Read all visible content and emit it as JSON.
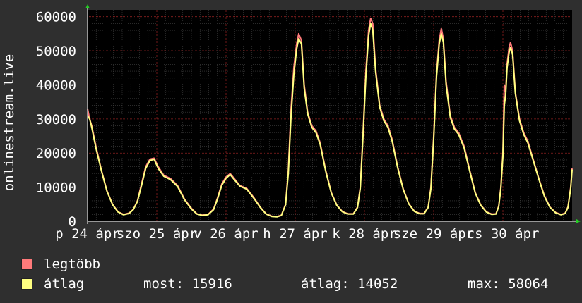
{
  "chart_data": {
    "type": "line",
    "ylabel": "onlinestream.live",
    "ylim": [
      0,
      62000
    ],
    "y_ticks": [
      "0",
      "10000",
      "20000",
      "30000",
      "40000",
      "50000",
      "60000"
    ],
    "y_tick_values": [
      0,
      10000,
      20000,
      30000,
      40000,
      50000,
      60000
    ],
    "x_tick_labels": [
      "p 24 ápr",
      "szo 25 ápr",
      "v 26 ápr",
      "h 27 ápr",
      "k 28 ápr",
      "sze 29 ápr",
      "cs 30 ápr"
    ],
    "x_range_days": [
      0,
      7
    ],
    "grid": true,
    "colors": {
      "legtobb": "#ff7a7a",
      "atlag": "#ffff80",
      "grid": "#8b2020",
      "background": "#000000"
    },
    "series": [
      {
        "name": "legtöbb",
        "points": [
          [
            0,
            33000
          ],
          [
            0.03,
            30000
          ],
          [
            0.06,
            28000
          ],
          [
            0.12,
            22000
          ],
          [
            0.2,
            15000
          ],
          [
            0.28,
            9000
          ],
          [
            0.36,
            5000
          ],
          [
            0.44,
            2800
          ],
          [
            0.52,
            2000
          ],
          [
            0.6,
            2400
          ],
          [
            0.66,
            3500
          ],
          [
            0.72,
            6000
          ],
          [
            0.78,
            11000
          ],
          [
            0.84,
            16000
          ],
          [
            0.9,
            18200
          ],
          [
            0.96,
            18500
          ],
          [
            1.02,
            16000
          ],
          [
            1.1,
            13500
          ],
          [
            1.2,
            12500
          ],
          [
            1.3,
            10500
          ],
          [
            1.4,
            6500
          ],
          [
            1.5,
            3800
          ],
          [
            1.58,
            2200
          ],
          [
            1.66,
            1800
          ],
          [
            1.74,
            2000
          ],
          [
            1.82,
            3600
          ],
          [
            1.88,
            7000
          ],
          [
            1.94,
            11000
          ],
          [
            2.0,
            13000
          ],
          [
            2.06,
            14000
          ],
          [
            2.12,
            12500
          ],
          [
            2.2,
            10500
          ],
          [
            2.3,
            9600
          ],
          [
            2.4,
            7000
          ],
          [
            2.5,
            4000
          ],
          [
            2.58,
            2200
          ],
          [
            2.66,
            1500
          ],
          [
            2.74,
            1400
          ],
          [
            2.8,
            1800
          ],
          [
            2.86,
            5000
          ],
          [
            2.9,
            15000
          ],
          [
            2.94,
            33000
          ],
          [
            2.98,
            45000
          ],
          [
            3.02,
            52000
          ],
          [
            3.05,
            55000
          ],
          [
            3.09,
            53000
          ],
          [
            3.13,
            40000
          ],
          [
            3.18,
            32000
          ],
          [
            3.24,
            28000
          ],
          [
            3.3,
            26500
          ],
          [
            3.36,
            23000
          ],
          [
            3.44,
            15000
          ],
          [
            3.52,
            8500
          ],
          [
            3.6,
            4800
          ],
          [
            3.68,
            2900
          ],
          [
            3.76,
            2200
          ],
          [
            3.84,
            2200
          ],
          [
            3.9,
            4200
          ],
          [
            3.94,
            10000
          ],
          [
            3.98,
            26000
          ],
          [
            4.02,
            44000
          ],
          [
            4.06,
            56000
          ],
          [
            4.09,
            59500
          ],
          [
            4.12,
            58000
          ],
          [
            4.16,
            45000
          ],
          [
            4.22,
            34000
          ],
          [
            4.28,
            30000
          ],
          [
            4.34,
            28000
          ],
          [
            4.4,
            24000
          ],
          [
            4.48,
            16000
          ],
          [
            4.56,
            9500
          ],
          [
            4.64,
            5200
          ],
          [
            4.72,
            3000
          ],
          [
            4.8,
            2300
          ],
          [
            4.86,
            2300
          ],
          [
            4.92,
            4200
          ],
          [
            4.96,
            10000
          ],
          [
            5.0,
            25000
          ],
          [
            5.04,
            43000
          ],
          [
            5.08,
            53000
          ],
          [
            5.11,
            56500
          ],
          [
            5.14,
            53500
          ],
          [
            5.18,
            41000
          ],
          [
            5.24,
            31000
          ],
          [
            5.3,
            27500
          ],
          [
            5.36,
            26000
          ],
          [
            5.44,
            22000
          ],
          [
            5.52,
            15000
          ],
          [
            5.6,
            8500
          ],
          [
            5.68,
            4800
          ],
          [
            5.76,
            2800
          ],
          [
            5.84,
            2100
          ],
          [
            5.9,
            2200
          ],
          [
            5.94,
            4500
          ],
          [
            5.97,
            10000
          ],
          [
            6.0,
            20000
          ],
          [
            6.02,
            40000
          ],
          [
            6.04,
            38000
          ],
          [
            6.06,
            46000
          ],
          [
            6.09,
            51000
          ],
          [
            6.11,
            52500
          ],
          [
            6.14,
            50000
          ],
          [
            6.18,
            38000
          ],
          [
            6.24,
            30000
          ],
          [
            6.3,
            26000
          ],
          [
            6.36,
            23500
          ],
          [
            6.44,
            18000
          ],
          [
            6.52,
            12500
          ],
          [
            6.6,
            7500
          ],
          [
            6.68,
            4200
          ],
          [
            6.76,
            2600
          ],
          [
            6.84,
            2000
          ],
          [
            6.9,
            2400
          ],
          [
            6.94,
            4200
          ],
          [
            6.98,
            10000
          ],
          [
            7.0,
            15500
          ]
        ]
      },
      {
        "name": "átlag",
        "points": [
          [
            0,
            31000
          ],
          [
            0.03,
            30000
          ],
          [
            0.06,
            27500
          ],
          [
            0.12,
            21500
          ],
          [
            0.2,
            14800
          ],
          [
            0.28,
            8800
          ],
          [
            0.36,
            4900
          ],
          [
            0.44,
            2700
          ],
          [
            0.52,
            1900
          ],
          [
            0.6,
            2300
          ],
          [
            0.66,
            3400
          ],
          [
            0.72,
            5800
          ],
          [
            0.78,
            10500
          ],
          [
            0.84,
            15500
          ],
          [
            0.9,
            17800
          ],
          [
            0.96,
            18200
          ],
          [
            1.02,
            15500
          ],
          [
            1.1,
            13200
          ],
          [
            1.2,
            12200
          ],
          [
            1.3,
            10200
          ],
          [
            1.4,
            6300
          ],
          [
            1.5,
            3600
          ],
          [
            1.58,
            2100
          ],
          [
            1.66,
            1700
          ],
          [
            1.74,
            1900
          ],
          [
            1.82,
            3400
          ],
          [
            1.88,
            6700
          ],
          [
            1.94,
            10600
          ],
          [
            2.0,
            12600
          ],
          [
            2.06,
            13700
          ],
          [
            2.12,
            12200
          ],
          [
            2.2,
            10300
          ],
          [
            2.3,
            9400
          ],
          [
            2.4,
            6800
          ],
          [
            2.5,
            3900
          ],
          [
            2.58,
            2100
          ],
          [
            2.66,
            1400
          ],
          [
            2.74,
            1300
          ],
          [
            2.8,
            1700
          ],
          [
            2.86,
            4800
          ],
          [
            2.9,
            14000
          ],
          [
            2.94,
            31000
          ],
          [
            2.98,
            43000
          ],
          [
            3.02,
            50500
          ],
          [
            3.05,
            53500
          ],
          [
            3.09,
            52000
          ],
          [
            3.13,
            39000
          ],
          [
            3.18,
            31500
          ],
          [
            3.24,
            27500
          ],
          [
            3.3,
            26000
          ],
          [
            3.36,
            22500
          ],
          [
            3.44,
            14700
          ],
          [
            3.52,
            8300
          ],
          [
            3.6,
            4700
          ],
          [
            3.68,
            2800
          ],
          [
            3.76,
            2100
          ],
          [
            3.84,
            2100
          ],
          [
            3.9,
            4000
          ],
          [
            3.94,
            9600
          ],
          [
            3.98,
            25000
          ],
          [
            4.02,
            42500
          ],
          [
            4.06,
            54500
          ],
          [
            4.09,
            58000
          ],
          [
            4.12,
            56000
          ],
          [
            4.16,
            44000
          ],
          [
            4.22,
            33500
          ],
          [
            4.28,
            29500
          ],
          [
            4.34,
            27500
          ],
          [
            4.4,
            23500
          ],
          [
            4.48,
            15700
          ],
          [
            4.56,
            9300
          ],
          [
            4.64,
            5100
          ],
          [
            4.72,
            2900
          ],
          [
            4.8,
            2200
          ],
          [
            4.86,
            2200
          ],
          [
            4.92,
            4000
          ],
          [
            4.96,
            9600
          ],
          [
            5.0,
            24000
          ],
          [
            5.04,
            42000
          ],
          [
            5.08,
            52000
          ],
          [
            5.11,
            55000
          ],
          [
            5.14,
            52500
          ],
          [
            5.18,
            40000
          ],
          [
            5.24,
            30500
          ],
          [
            5.3,
            27000
          ],
          [
            5.36,
            25500
          ],
          [
            5.44,
            21500
          ],
          [
            5.52,
            14700
          ],
          [
            5.6,
            8300
          ],
          [
            5.68,
            4700
          ],
          [
            5.76,
            2700
          ],
          [
            5.84,
            2000
          ],
          [
            5.9,
            2100
          ],
          [
            5.94,
            4300
          ],
          [
            5.97,
            9600
          ],
          [
            6.0,
            19000
          ],
          [
            6.02,
            34000
          ],
          [
            6.04,
            37000
          ],
          [
            6.06,
            45000
          ],
          [
            6.09,
            49500
          ],
          [
            6.11,
            51000
          ],
          [
            6.14,
            49000
          ],
          [
            6.18,
            37500
          ],
          [
            6.24,
            29500
          ],
          [
            6.3,
            25500
          ],
          [
            6.36,
            23000
          ],
          [
            6.44,
            17700
          ],
          [
            6.52,
            12300
          ],
          [
            6.6,
            7300
          ],
          [
            6.68,
            4100
          ],
          [
            6.76,
            2500
          ],
          [
            6.84,
            1900
          ],
          [
            6.9,
            2300
          ],
          [
            6.94,
            4000
          ],
          [
            6.98,
            9600
          ],
          [
            7.0,
            15200
          ]
        ]
      }
    ]
  },
  "legend": [
    {
      "label": "legtöbb",
      "color": "#ff7a7a"
    },
    {
      "label": "átlag",
      "color": "#ffff80"
    }
  ],
  "stats": {
    "most": "most: 15916",
    "atlag": "átlag: 14052",
    "max": "max: 58064"
  }
}
